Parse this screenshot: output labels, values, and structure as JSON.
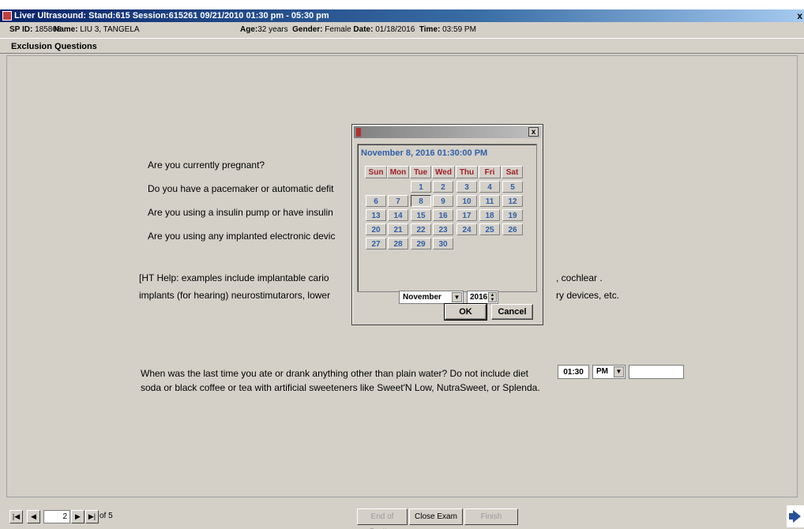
{
  "window": {
    "title": "Liver Ultrasound: Stand:615 Session:615261 09/21/2010 01:30 pm - 05:30 pm",
    "close_glyph": "x"
  },
  "patient": {
    "sp_id_label": "SP ID:",
    "sp_id": "185868",
    "name_label": "Name:",
    "name": "LIU 3, TANGELA",
    "age_label": "Age:",
    "age": "32 years",
    "gender_label": "Gender:",
    "gender": "Female",
    "date_label": "Date:",
    "date": "01/18/2016",
    "time_label": "Time:",
    "time": "03:59 PM"
  },
  "section": {
    "title": "Exclusion Questions"
  },
  "questions": [
    "Are you currently pregnant?",
    "Do you have a pacemaker or automatic defit",
    "Are you using a insulin pump or have insulin",
    "Are you using any implanted electronic devic"
  ],
  "help": {
    "line1_left": "[HT Help: examples include implantable cario",
    "line1_right": ", cochlear .",
    "line2_left": "implants (for hearing) neurostimutarors, lower",
    "line2_right": "ry devices, etc."
  },
  "last_question": {
    "text": "When was the last time you ate or drank anything other than plain water?  Do not include diet soda or black coffee or tea with artificial sweeteners like Sweet'N Low, NutraSweet, or Splenda.",
    "time_value": "01:30",
    "ampm_value": "PM",
    "extra_value": ""
  },
  "calendar": {
    "header": "November 8, 2016  01:30:00 PM",
    "weekdays": [
      "Sun",
      "Mon",
      "Tue",
      "Wed",
      "Thu",
      "Fri",
      "Sat"
    ],
    "selected_day": "8",
    "month": "November",
    "year": "2016",
    "ok_label": "OK",
    "cancel_label": "Cancel"
  },
  "footer": {
    "page_value": "2",
    "of_label": "of 5",
    "end_of_section_label": "End of Section",
    "close_exam_label": "Close Exam",
    "finish_label": "Finish"
  }
}
